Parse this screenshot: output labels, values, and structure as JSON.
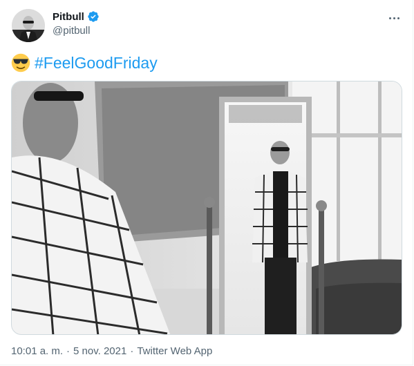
{
  "author": {
    "name": "Pitbull",
    "handle": "@pitbull",
    "avatar_icon": "avatar-photo",
    "verified_icon": "verified-badge-icon",
    "verified_color": "#1d9bf0"
  },
  "more_icon": "more-options-icon",
  "tweet": {
    "emoji": "sunglasses-emoji",
    "hashtag": "#FeelGoodFriday",
    "hashtag_color": "#1d9bf0"
  },
  "media": {
    "type": "photo",
    "description": "Black and white photo: man in checked jacket looking into a standing mirror"
  },
  "meta": {
    "time": "10:01 a. m.",
    "date": "5 nov. 2021",
    "source": "Twitter Web App"
  }
}
